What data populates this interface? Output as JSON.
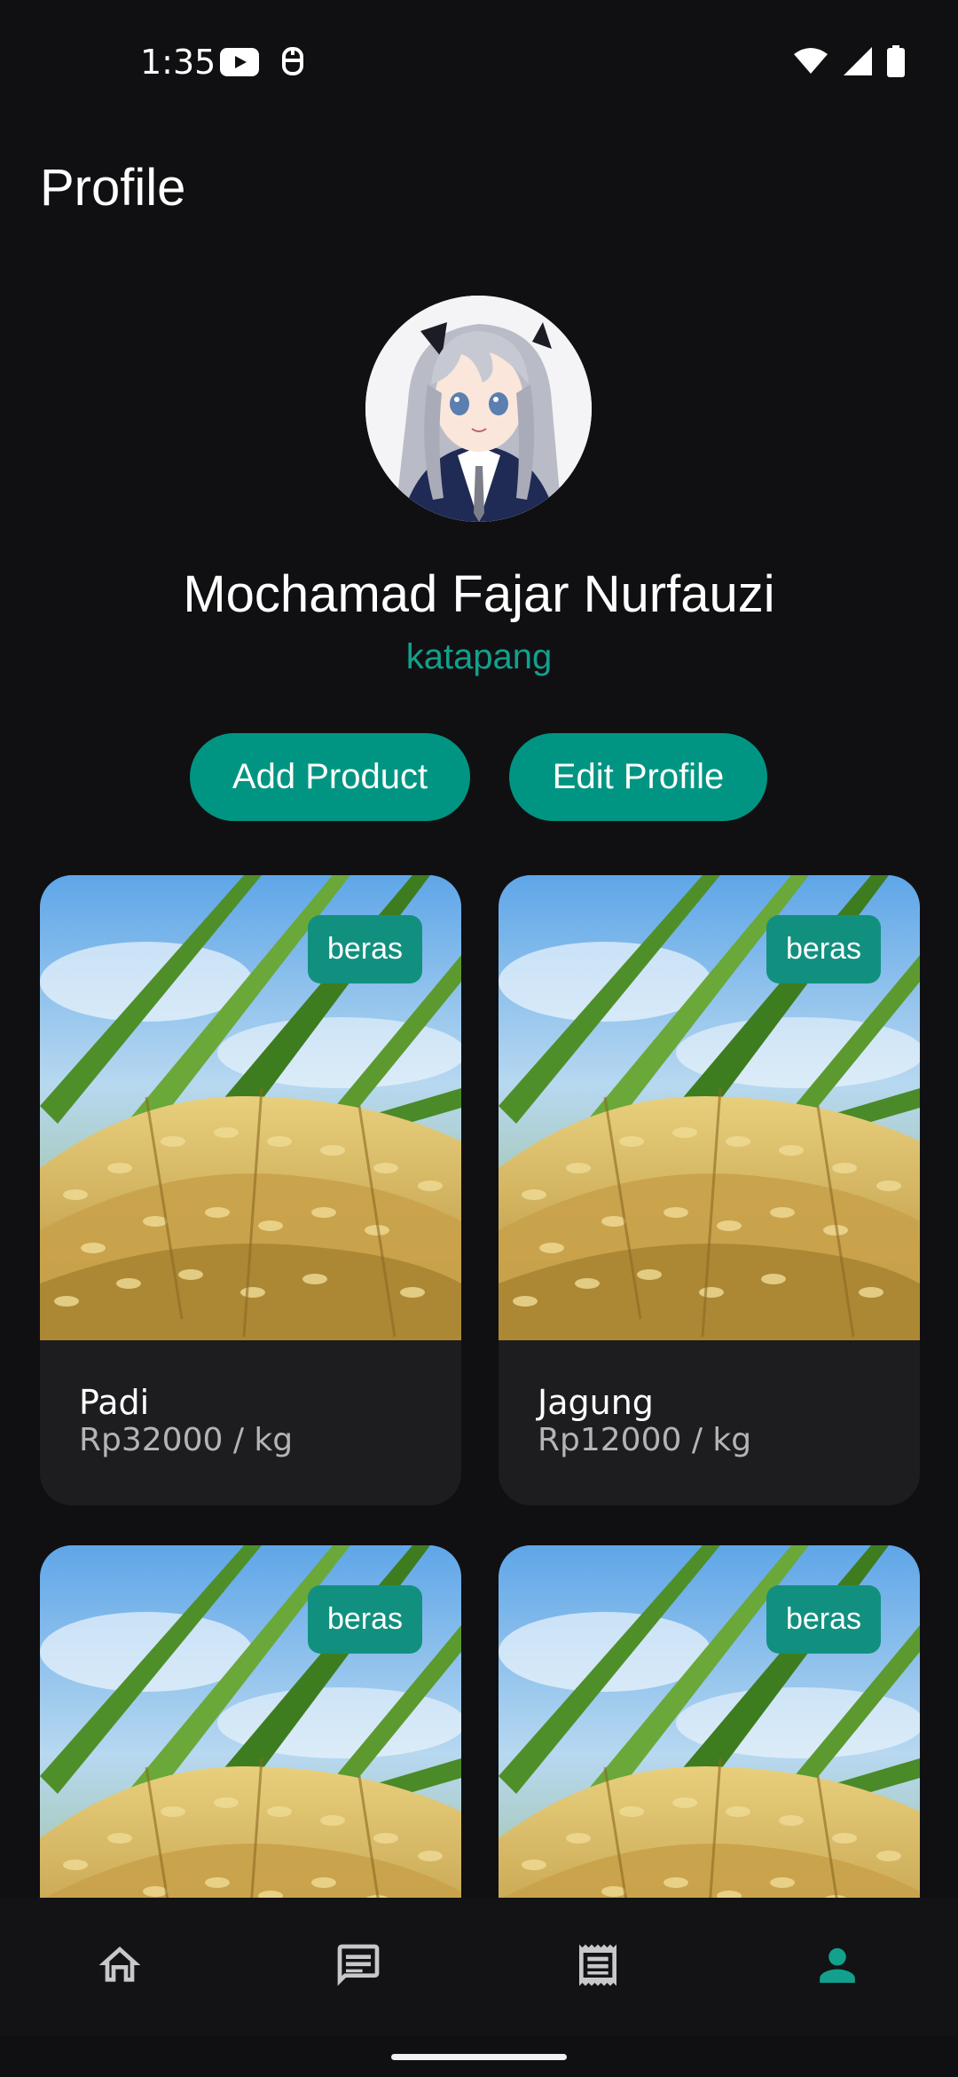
{
  "status_bar": {
    "time": "1:35",
    "icons": [
      "youtube-icon",
      "app-notification-icon",
      "wifi-icon",
      "cellular-icon",
      "battery-icon"
    ]
  },
  "header": {
    "title": "Profile"
  },
  "profile": {
    "name": "Mochamad Fajar Nurfauzi",
    "location": "katapang",
    "avatar_icon": "avatar-illustration"
  },
  "actions": {
    "add_product": "Add Product",
    "edit_profile": "Edit Profile"
  },
  "products": [
    {
      "name": "Padi",
      "price": "Rp32000 / kg",
      "category": "beras"
    },
    {
      "name": "Jagung",
      "price": "Rp12000 / kg",
      "category": "beras"
    },
    {
      "category": "beras"
    },
    {
      "category": "beras"
    }
  ],
  "bottom_nav": {
    "items": [
      {
        "icon": "home-icon",
        "active": false
      },
      {
        "icon": "chat-icon",
        "active": false
      },
      {
        "icon": "receipt-icon",
        "active": false
      },
      {
        "icon": "person-icon",
        "active": true
      }
    ],
    "active_color": "#13a08c",
    "inactive_color": "#c8c8cc"
  },
  "colors": {
    "accent": "#009582",
    "accent_text": "#13a08c",
    "background": "#101012",
    "card": "#1d1d1f"
  }
}
